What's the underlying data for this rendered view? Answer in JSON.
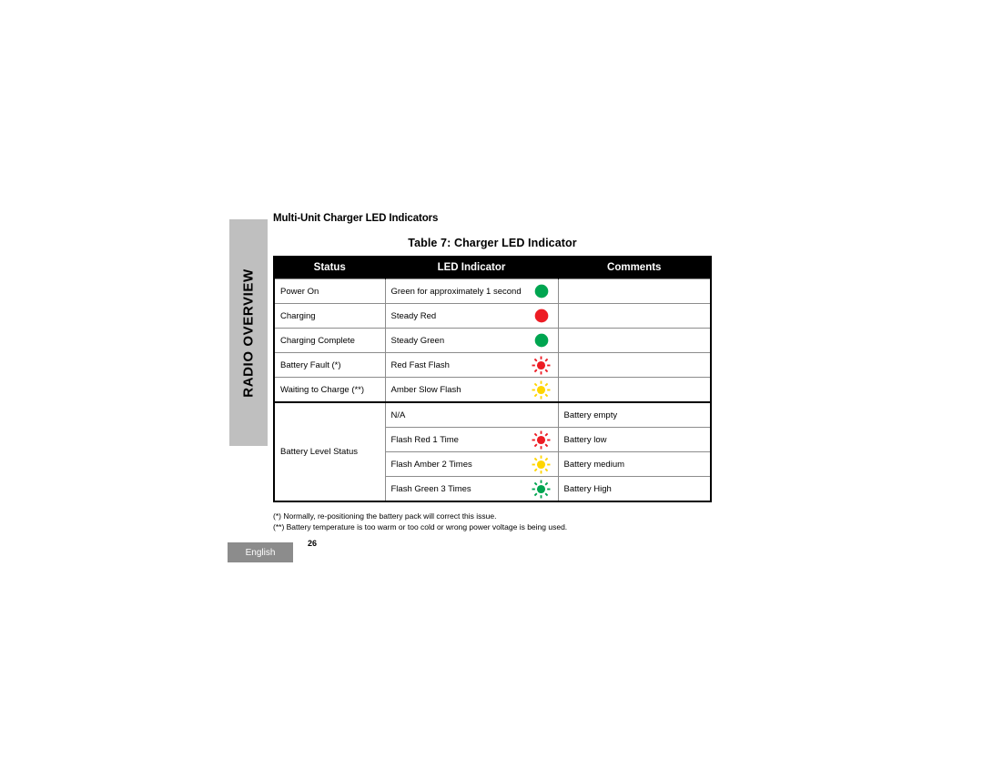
{
  "side_tab": {
    "label": "RADIO OVERVIEW",
    "background": "#bfbfbf"
  },
  "section": {
    "heading": "Multi-Unit Charger LED Indicators",
    "table_caption": "Table 7: Charger LED Indicator"
  },
  "table": {
    "headers": {
      "status": "Status",
      "led_indicator": "LED Indicator",
      "comments": "Comments"
    },
    "rows": [
      {
        "status": "Power On",
        "led_indicator": "Green for approximately 1 second",
        "icon": "led-solid-green-icon",
        "comments": ""
      },
      {
        "status": "Charging",
        "led_indicator": "Steady Red",
        "icon": "led-solid-red-icon",
        "comments": ""
      },
      {
        "status": "Charging Complete",
        "led_indicator": "Steady Green",
        "icon": "led-solid-green-icon",
        "comments": ""
      },
      {
        "status": "Battery Fault (*)",
        "led_indicator": "Red Fast Flash",
        "icon": "led-flash-red-icon",
        "comments": ""
      },
      {
        "status": "Waiting to Charge (**)",
        "led_indicator": "Amber Slow Flash",
        "icon": "led-flash-amber-icon",
        "comments": ""
      }
    ],
    "battery_group": {
      "status": "Battery Level Status",
      "rows": [
        {
          "led_indicator": "N/A",
          "icon": "none",
          "comments": "Battery empty"
        },
        {
          "led_indicator": "Flash Red 1 Time",
          "icon": "led-flash-red-icon",
          "comments": "Battery low"
        },
        {
          "led_indicator": "Flash Amber 2 Times",
          "icon": "led-flash-amber-icon",
          "comments": "Battery medium"
        },
        {
          "led_indicator": "Flash Green 3 Times",
          "icon": "led-flash-green-icon",
          "comments": "Battery High"
        }
      ]
    }
  },
  "footnotes": {
    "single_asterisk": "(*) Normally, re-positioning the battery pack will correct this issue.",
    "double_asterisk": "(**) Battery temperature is too warm or too cold or wrong power voltage is being used."
  },
  "footer": {
    "language": "English",
    "page_number": "26"
  },
  "colors": {
    "led_green": "#00A550",
    "led_red": "#ED1C24",
    "led_amber": "#FFD500",
    "header_background": "#000000",
    "tab_gray": "#bfbfbf",
    "badge_gray": "#8c8c8c"
  }
}
